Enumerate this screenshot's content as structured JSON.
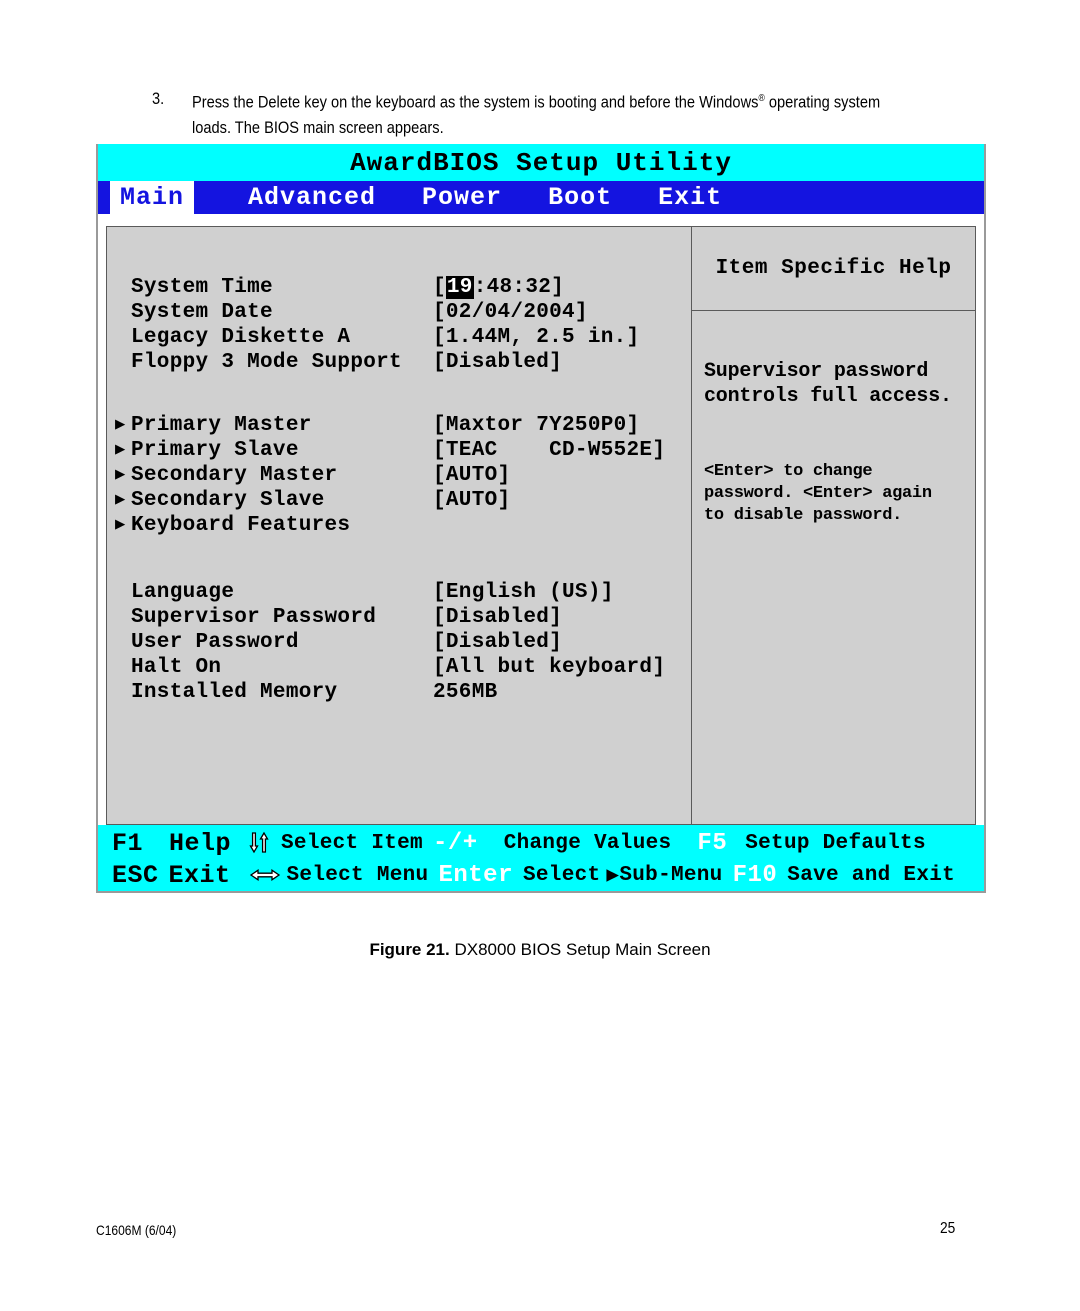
{
  "step": {
    "number": "3.",
    "text": "Press the Delete key on the keyboard as the system is booting and before the Windows",
    "superscript": "®",
    "text_after": " operating system loads. The BIOS main screen appears."
  },
  "bios": {
    "title": "AwardBIOS Setup Utility",
    "tabs": [
      {
        "label": "Main",
        "selected": true
      },
      {
        "label": "Advanced",
        "selected": false
      },
      {
        "label": "Power",
        "selected": false
      },
      {
        "label": "Boot",
        "selected": false
      },
      {
        "label": "Exit",
        "selected": false
      }
    ],
    "rows_group1": [
      {
        "label": "System Time",
        "value_prefix": "[",
        "value_highlight": "19",
        "value_suffix": ":48:32]",
        "submenu": false
      },
      {
        "label": "System Date",
        "value": "[02/04/2004]",
        "submenu": false
      },
      {
        "label": "Legacy Diskette A",
        "value": "[1.44M, 2.5 in.]",
        "submenu": false
      },
      {
        "label": "Floppy 3 Mode Support",
        "value": "[Disabled]",
        "submenu": false
      }
    ],
    "rows_group2": [
      {
        "label": "Primary Master",
        "value": "[Maxtor 7Y250P0]",
        "submenu": true
      },
      {
        "label": "Primary Slave",
        "value": "[TEAC    CD-W552E]",
        "submenu": true
      },
      {
        "label": "Secondary Master",
        "value": "[AUTO]",
        "submenu": true
      },
      {
        "label": "Secondary Slave",
        "value": "[AUTO]",
        "submenu": true
      },
      {
        "label": "Keyboard Features",
        "value": "",
        "submenu": true
      }
    ],
    "rows_group3": [
      {
        "label": "Language",
        "value": "[English (US)]",
        "submenu": false
      },
      {
        "label": "Supervisor Password",
        "value": "[Disabled]",
        "submenu": false
      },
      {
        "label": "User Password",
        "value": "[Disabled]",
        "submenu": false
      },
      {
        "label": "Halt On",
        "value": "[All but keyboard]",
        "submenu": false
      },
      {
        "label": "Installed Memory",
        "value": "256MB",
        "submenu": false
      }
    ],
    "help": {
      "heading": "Item Specific Help",
      "line1": "Supervisor password",
      "line2": "controls full access.",
      "line3": "<Enter> to change",
      "line4": "password. <Enter> again",
      "line5": "to disable password."
    },
    "footer": {
      "f1_key": "F1",
      "f1_label": "Help",
      "updown_label": "Select Item",
      "plusminus_key": "-/+",
      "plusminus_label": "Change Values",
      "f5_key": "F5",
      "f5_label": "Setup Defaults",
      "esc_key": "ESC",
      "esc_label": "Exit",
      "leftright_label": "Select Menu",
      "enter_key": "Enter",
      "enter_label": "Select",
      "submenu_label": "Sub-Menu",
      "f10_key": "F10",
      "f10_label": "Save and Exit"
    },
    "colors": {
      "title_bar": "#00ffff",
      "tab_bar": "#1414e0",
      "panel": "#d0d0d0",
      "footer_bar": "#00ffff",
      "highlight_bg": "#000000"
    }
  },
  "figure_caption": {
    "label": "Figure 21.",
    "text": " DX8000 BIOS Setup Main Screen"
  },
  "page_footer": {
    "doc_id": "C1606M (6/04)",
    "page_number": "25"
  }
}
